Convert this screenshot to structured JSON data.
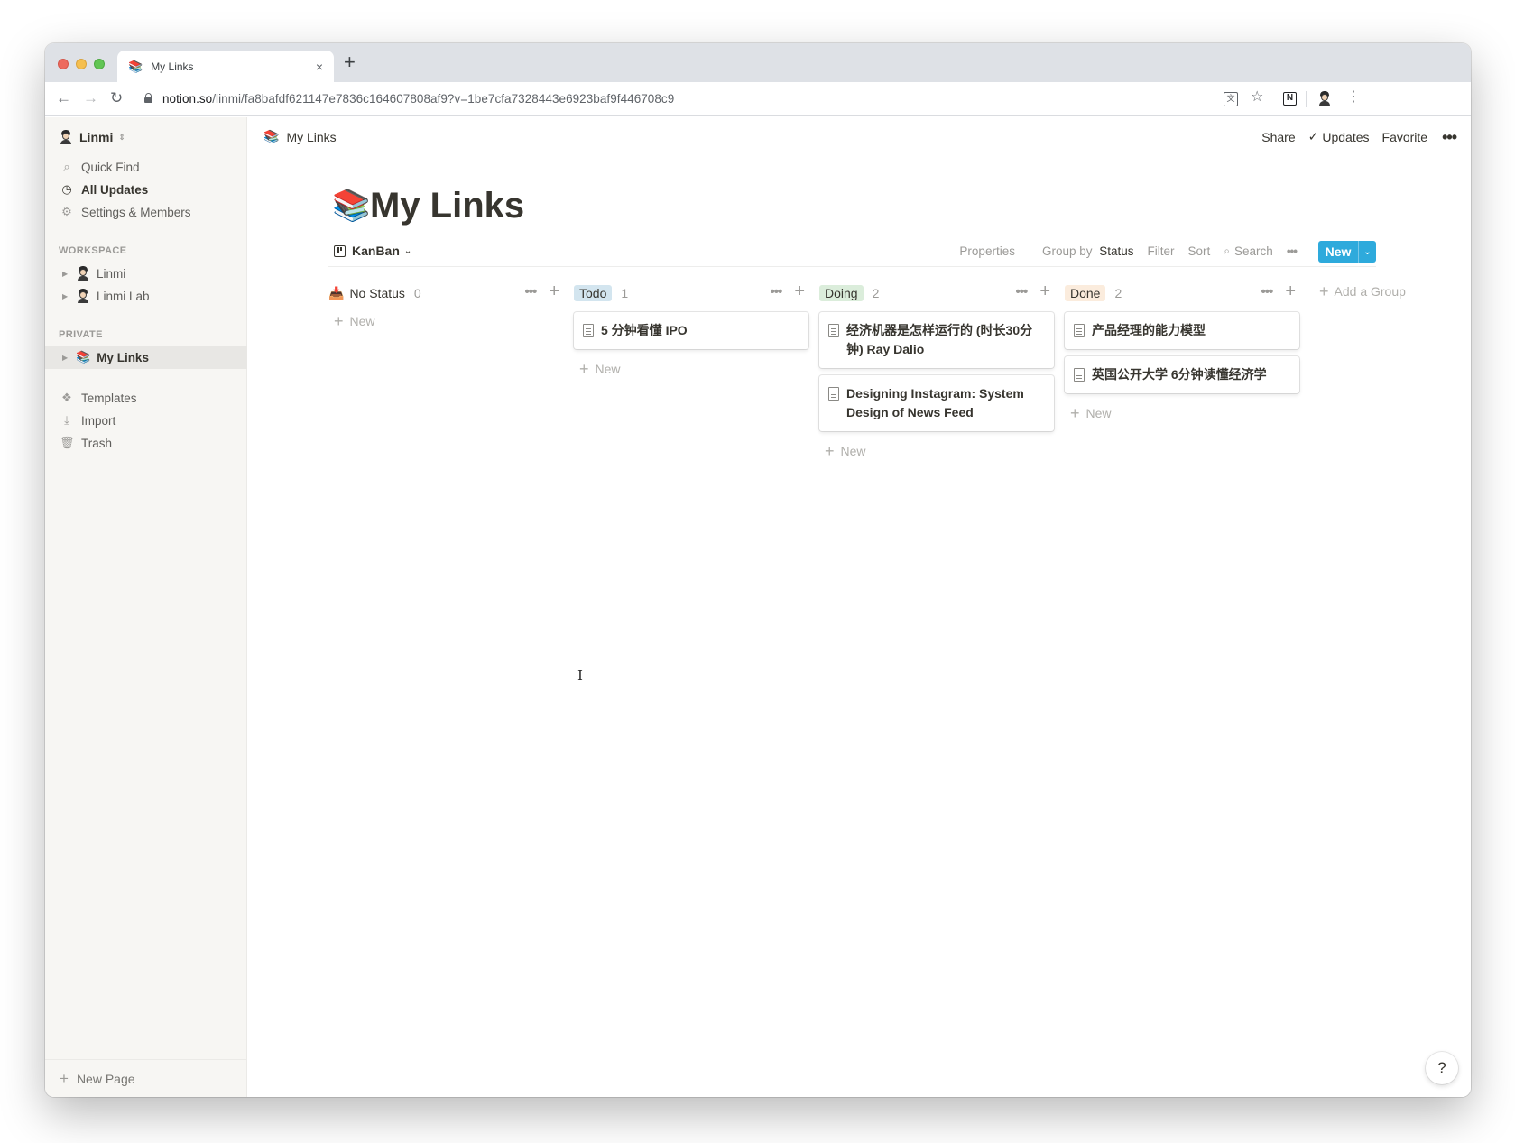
{
  "browser": {
    "tab_title": "My Links",
    "tab_favicon": "📚",
    "tab_close": "×",
    "new_tab": "+",
    "url_host": "notion.so",
    "url_path": "/linmi/fa8bafdf621147e7836c164607808af9?v=1be7cfa7328443e6923baf9f446708c9",
    "nav_back": "←",
    "nav_forward": "→",
    "nav_reload": "↻"
  },
  "sidebar": {
    "workspace_name": "Linmi",
    "top_items": [
      {
        "label": "Quick Find",
        "icon": "search-icon"
      },
      {
        "label": "All Updates",
        "icon": "clock-icon"
      },
      {
        "label": "Settings & Members",
        "icon": "gear-icon"
      }
    ],
    "workspace_section": "WORKSPACE",
    "workspace_pages": [
      {
        "label": "Linmi"
      },
      {
        "label": "Linmi Lab"
      }
    ],
    "private_section": "PRIVATE",
    "private_pages": [
      {
        "label": "My Links",
        "emoji": "📚"
      }
    ],
    "bottom_items": [
      {
        "label": "Templates",
        "icon": "templates-icon"
      },
      {
        "label": "Import",
        "icon": "import-icon"
      },
      {
        "label": "Trash",
        "icon": "trash-icon"
      }
    ],
    "new_page_label": "New Page"
  },
  "topbar": {
    "breadcrumb": "My Links",
    "breadcrumb_emoji": "📚",
    "share": "Share",
    "updates": "Updates",
    "favorite": "Favorite"
  },
  "page": {
    "emoji": "📚",
    "title": "My Links",
    "view_name": "KanBan",
    "properties": "Properties",
    "group_by_prefix": "Group by",
    "group_by_value": "Status",
    "filter": "Filter",
    "sort": "Sort",
    "search": "Search",
    "new_button": "New"
  },
  "board": {
    "new_card_label": "New",
    "add_group": "Add a Group",
    "columns": [
      {
        "title": "No Status",
        "count": "0",
        "pill_color": "",
        "cards": []
      },
      {
        "title": "Todo",
        "count": "1",
        "pill_color": "#d3e5ef",
        "cards": [
          "5 分钟看懂 IPO"
        ]
      },
      {
        "title": "Doing",
        "count": "2",
        "pill_color": "#dbeddb",
        "cards": [
          "经济机器是怎样运行的 (时长30分钟) Ray Dalio",
          "Designing Instagram: System Design of News Feed"
        ]
      },
      {
        "title": "Done",
        "count": "2",
        "pill_color": "#fbecdd",
        "cards": [
          "产品经理的能力模型",
          "英国公开大学 6分钟读懂经济学"
        ]
      }
    ]
  },
  "help": "?"
}
